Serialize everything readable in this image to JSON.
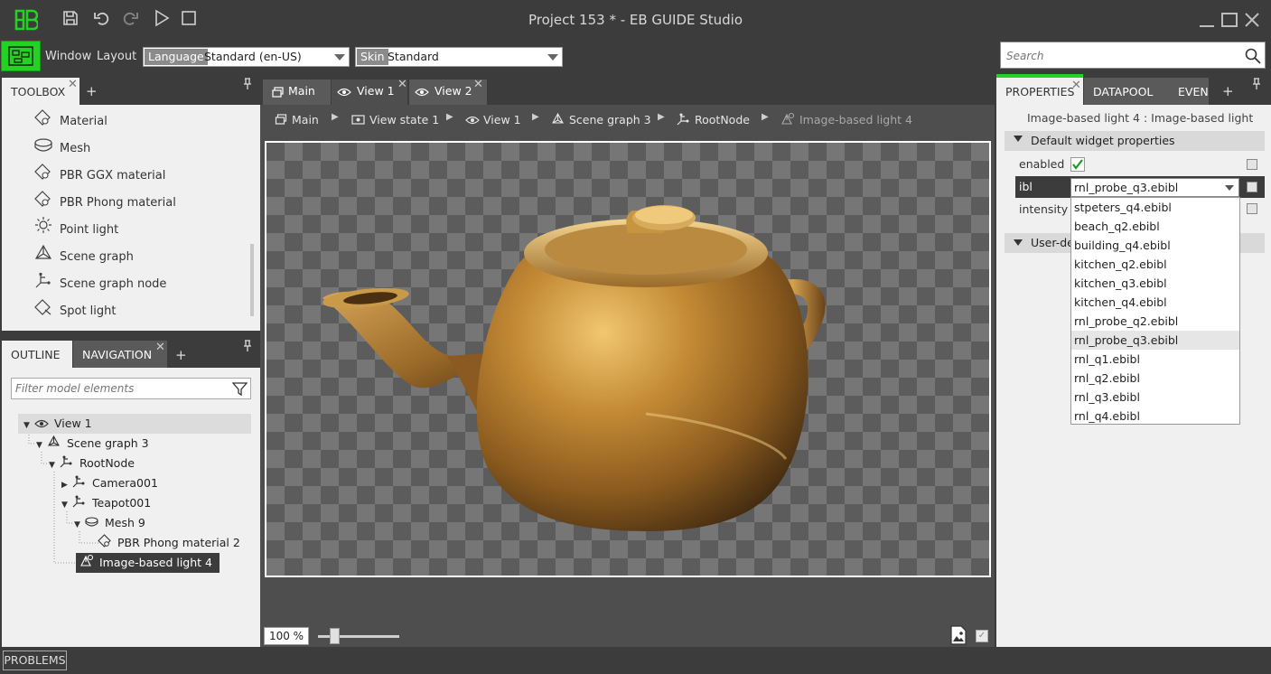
{
  "window": {
    "title": "Project 153 * - EB GUIDE Studio"
  },
  "menu": {
    "items": [
      "Window",
      "Layout"
    ],
    "language_label": "Language",
    "language_value": "Standard (en-US)",
    "skin_label": "Skin",
    "skin_value": "Standard",
    "search_placeholder": "Search"
  },
  "toolbox": {
    "tab": "TOOLBOX",
    "items": [
      {
        "label": "Material",
        "icon": "material-icon"
      },
      {
        "label": "Mesh",
        "icon": "mesh-icon"
      },
      {
        "label": "PBR GGX material",
        "icon": "material-icon"
      },
      {
        "label": "PBR Phong material",
        "icon": "material-icon"
      },
      {
        "label": "Point light",
        "icon": "point-light-icon"
      },
      {
        "label": "Scene graph",
        "icon": "scene-graph-icon"
      },
      {
        "label": "Scene graph node",
        "icon": "scene-graph-node-icon"
      },
      {
        "label": "Spot light",
        "icon": "spot-light-icon"
      }
    ]
  },
  "outline": {
    "tabs": [
      "OUTLINE",
      "NAVIGATION"
    ],
    "filter_placeholder": "Filter model elements",
    "tree": [
      {
        "label": "View 1",
        "indent": 0,
        "expanded": true,
        "icon": "eye-icon"
      },
      {
        "label": "Scene graph 3",
        "indent": 1,
        "expanded": true,
        "icon": "scene-graph-icon"
      },
      {
        "label": "RootNode",
        "indent": 2,
        "expanded": true,
        "icon": "node-icon"
      },
      {
        "label": "Camera001",
        "indent": 3,
        "expanded": false,
        "icon": "node-icon"
      },
      {
        "label": "Teapot001",
        "indent": 3,
        "expanded": true,
        "icon": "node-icon"
      },
      {
        "label": "Mesh 9",
        "indent": 4,
        "expanded": true,
        "icon": "mesh-icon"
      },
      {
        "label": "PBR Phong material 2",
        "indent": 5,
        "expanded": null,
        "icon": "material-icon"
      },
      {
        "label": "Image-based light 4",
        "indent": 3,
        "expanded": null,
        "icon": "ibl-icon"
      }
    ]
  },
  "editor": {
    "tabs": [
      "Main",
      "View 1",
      "View 2"
    ],
    "breadcrumb": [
      "Main",
      "View state 1",
      "View 1",
      "Scene graph 3",
      "RootNode",
      "Image-based light 4"
    ],
    "zoom": "100 %",
    "zoom_fraction": 0.2
  },
  "properties": {
    "tabs": [
      "PROPERTIES",
      "DATAPOOL",
      "EVEN"
    ],
    "heading": "Image-based light 4 : Image-based light",
    "section_default": "Default widget properties",
    "section_user": "User-de",
    "rows": {
      "enabled_label": "enabled",
      "enabled_value": true,
      "ibl_label": "ibl",
      "ibl_value": "rnl_probe_q3.ebibl",
      "intensity_label": "intensity"
    },
    "ibl_options": [
      "stpeters_q4.ebibl",
      "beach_q2.ebibl",
      "building_q4.ebibl",
      "kitchen_q2.ebibl",
      "kitchen_q3.ebibl",
      "kitchen_q4.ebibl",
      "rnl_probe_q2.ebibl",
      "rnl_probe_q3.ebibl",
      "rnl_q1.ebibl",
      "rnl_q2.ebibl",
      "rnl_q3.ebibl",
      "rnl_q4.ebibl"
    ],
    "ibl_selected_index": 7
  },
  "status": {
    "problems": "PROBLEMS"
  },
  "colors": {
    "accent": "#23d323",
    "chrome": "#3c3c3c",
    "panel": "#f0f0f0",
    "teapot": "#b9832e"
  }
}
